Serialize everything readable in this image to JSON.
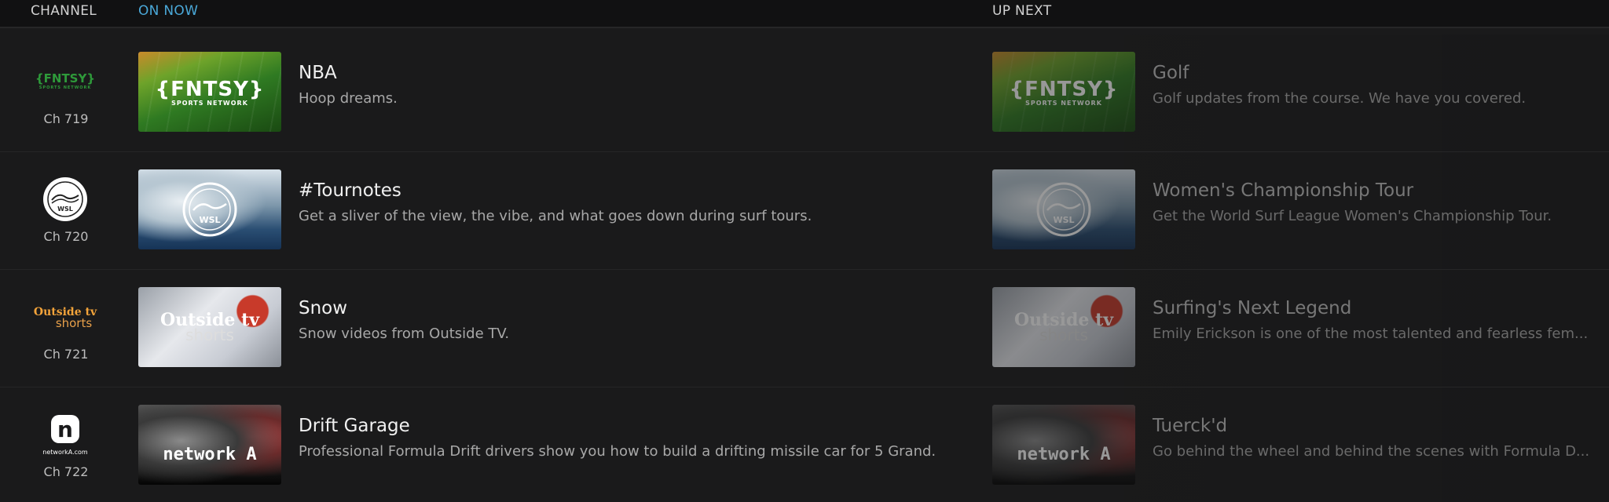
{
  "header": {
    "channel_label": "CHANNEL",
    "on_now_label": "ON NOW",
    "up_next_label": "UP NEXT"
  },
  "colors": {
    "accent": "#4aa8d8",
    "background": "#1a1a1b",
    "header_bg": "#111112"
  },
  "rows": [
    {
      "channel_number": "Ch 719",
      "channel_logo_text": "{FNTSY}",
      "channel_logo_sub": "SPORTS NETWORK",
      "now": {
        "title": "NBA",
        "description": "Hoop dreams.",
        "thumb_text": "{FNTSY}",
        "thumb_sub": "SPORTS NETWORK"
      },
      "next": {
        "title": "Golf",
        "description": "Golf updates from the course. We have you covered.",
        "thumb_text": "{FNTSY}",
        "thumb_sub": "SPORTS NETWORK"
      }
    },
    {
      "channel_number": "Ch 720",
      "channel_logo_text": "WSL",
      "now": {
        "title": "#Tournotes",
        "description": "Get a sliver of the view, the vibe, and what goes down during surf tours.",
        "thumb_text": "WSL"
      },
      "next": {
        "title": "Women's Championship Tour",
        "description": "Get the World Surf League Women's Championship Tour.",
        "thumb_text": "WSL"
      }
    },
    {
      "channel_number": "Ch 721",
      "channel_logo_text": "Outside tv",
      "channel_logo_sub": "shorts",
      "now": {
        "title": "Snow",
        "description": "Snow videos from Outside TV.",
        "thumb_text": "Outside tv",
        "thumb_sub": "shorts"
      },
      "next": {
        "title": "Surfing's Next Legend",
        "description": "Emily Erickson is one of the most talented and fearless fem...",
        "thumb_text": "Outside tv",
        "thumb_sub": "shorts"
      }
    },
    {
      "channel_number": "Ch 722",
      "channel_logo_text": "n",
      "channel_logo_sub": "networkA.com",
      "now": {
        "title": "Drift Garage",
        "description": "Professional Formula Drift drivers show you how to build a drifting missile car for 5 Grand.",
        "thumb_text": "network A"
      },
      "next": {
        "title": "Tuerck'd",
        "description": "Go behind the wheel and behind the scenes with Formula D...",
        "thumb_text": "network A"
      }
    }
  ]
}
